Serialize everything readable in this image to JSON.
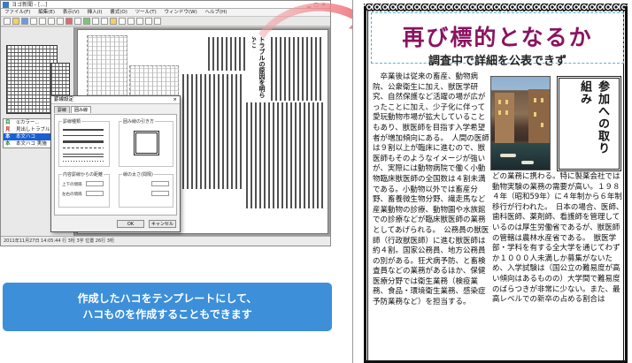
{
  "app": {
    "title": "ヨゴ新聞 - [...]",
    "menus": [
      "ファイル(F)",
      "編集(E)",
      "表示(V)",
      "挿入(I)",
      "書式(O)",
      "ツール(T)",
      "ウィンドウ(W)",
      "ヘルプ(H)"
    ],
    "documents": [
      {
        "tag": "目",
        "label": "①カラー..."
      },
      {
        "tag": "見",
        "label": "見出しトラブル"
      },
      {
        "tag": "本",
        "label": "本文ハコ"
      },
      {
        "tag": "本",
        "label": "本文ハコ 実施"
      }
    ],
    "vertical_head": "トラブルの原因を明らかに",
    "status": "2011年11月27日 14:05:44   行 3桁 3字 位置 26行 3桁"
  },
  "dialog": {
    "title": "罫線設定",
    "close": "×",
    "tabs": [
      "罫線",
      "囲み線"
    ],
    "group_line": "罫線種類",
    "group_preview": "囲み線の引き方",
    "group_margin_h": "内容罫線からの距離",
    "group_margin_v": "線の太さ(間隔)",
    "top_label": "上下の間隔",
    "side_label": "左右の間隔",
    "ok": "OK",
    "cancel": "キャンセル"
  },
  "caption": {
    "line1": "作成したハコをテンプレートにして、",
    "line2": "ハコものを作成することもできます"
  },
  "paper": {
    "headline": "再び標的となるか",
    "subhead": "調査中で詳細を公表できず",
    "side_title": "参加への取り組み",
    "left_text": "　卒業後は従来の畜産、動物病院、公衆衛生に加え、獣医学研究、自然保護など活躍の場が広がったことに加え、少子化に伴って愛玩動物市場が拡大していることもあり、獣医師を目指す入学希望者が増加傾向にある。　人間の医師は９割以上が臨床に進むので、獣医師もそのようなイメージが強いが、実際には動物病院で働く小動物臨床獣医師の全国数は４割未満である。小動物以外では畜産分野、畜養微生物分野、繊走馬など産業動物の診療、動物園や水族館での診療などが臨床獣医師の業務としてあげられる。　公務員の獣医師（行政獣医師）に進む獣医師は約４割。国家公務員、地方公務員の別がある。狂犬病予防、と畜検査員などの業務があるほか、保健医療分野では衛生業務（検疫業務、食品・環境衛生業務、感染症予防業務など）を担当する。",
    "right_text": "どの業務に携わる。特に製薬会社では動物実験の業務の需要が高い。１９８４年（昭和59年）に４年制から６年制移行が行われた。　日本の場合、医師、歯科医師、薬剤師、看護師を管理しているのは厚生労働省であるが、獣医師の管轄は農林水産省である。　獣医学部・学科を有する全大学を通じてわずか１０００人未満しか募集がないため、入学試験は（国公立の難易度が高い傾向はあるものの）大学間で難易度のばらつきが非常に少ない。また、最高レベルでの新卒の占める割合は"
  }
}
